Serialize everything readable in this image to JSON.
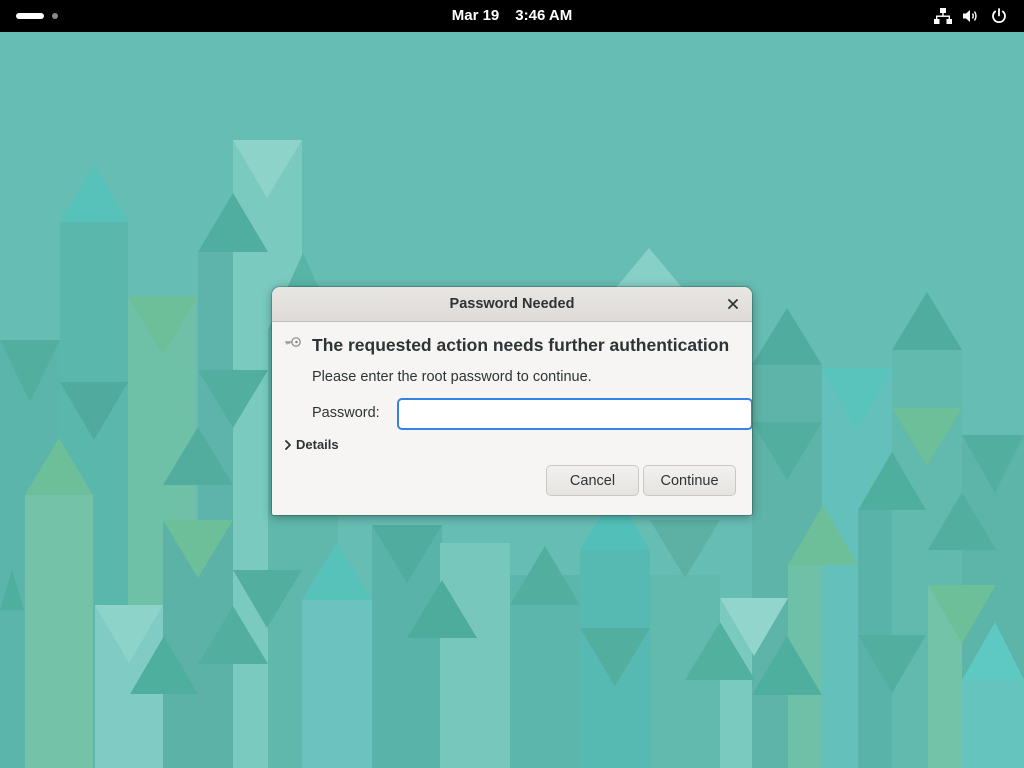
{
  "topbar": {
    "date": "Mar 19",
    "time": "3:46 AM",
    "icons": [
      "network-wired-icon",
      "volume-icon",
      "power-icon"
    ]
  },
  "dialog": {
    "title": "Password Needed",
    "icon": "key-icon",
    "headline": "The requested action needs further authentication",
    "description": "Please enter the root password to continue.",
    "password_label": "Password:",
    "password_value": "",
    "details_label": "Details",
    "cancel_label": "Cancel",
    "continue_label": "Continue"
  },
  "colors": {
    "wallpaper_base": "#66bdb3",
    "accent": "#3584e4",
    "topbar": "#000000"
  }
}
